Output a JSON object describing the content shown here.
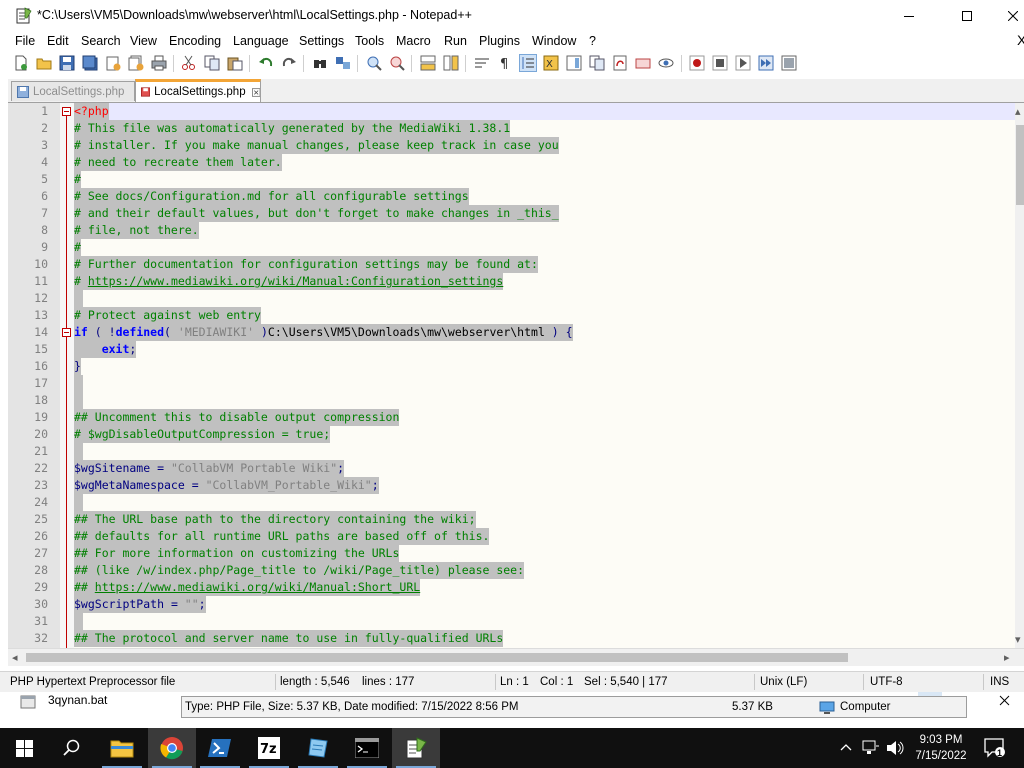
{
  "window": {
    "title": "*C:\\Users\\VM5\\Downloads\\mw\\webserver\\html\\LocalSettings.php - Notepad++"
  },
  "menu": {
    "items": [
      "File",
      "Edit",
      "Search",
      "View",
      "Encoding",
      "Language",
      "Settings",
      "Tools",
      "Macro",
      "Run",
      "Plugins",
      "Window",
      "?"
    ],
    "close_glyph": "X"
  },
  "toolbar": {
    "buttons": [
      "new-file",
      "open-file",
      "save",
      "save-all",
      "close",
      "close-all",
      "print",
      "cut",
      "copy",
      "paste",
      "undo",
      "redo",
      "find",
      "replace",
      "zoom-in",
      "zoom-out",
      "sync-vertical",
      "sync-horizontal",
      "word-wrap",
      "show-all-characters",
      "indent-guide",
      "user-defined-language",
      "document-map",
      "function-list",
      "folder-as-workspace",
      "monitoring",
      "start-recording",
      "stop-recording",
      "playback-macro",
      "run-macro-multiple",
      "save-macro"
    ]
  },
  "tabs": [
    {
      "label": "LocalSettings.php",
      "active": false
    },
    {
      "label": "LocalSettings.php",
      "active": true
    }
  ],
  "editor": {
    "lines": [
      {
        "n": "1",
        "tokens": [
          [
            "tag",
            "<?php"
          ]
        ]
      },
      {
        "n": "2",
        "tokens": [
          [
            "cmt",
            "# This file was automatically generated by the MediaWiki 1.38.1"
          ]
        ]
      },
      {
        "n": "3",
        "tokens": [
          [
            "cmt",
            "# installer. If you make manual changes, please keep track in case you"
          ]
        ]
      },
      {
        "n": "4",
        "tokens": [
          [
            "cmt",
            "# need to recreate them later."
          ]
        ]
      },
      {
        "n": "5",
        "tokens": [
          [
            "cmt",
            "#"
          ]
        ]
      },
      {
        "n": "6",
        "tokens": [
          [
            "cmt",
            "# See docs/Configuration.md for all configurable settings"
          ]
        ]
      },
      {
        "n": "7",
        "tokens": [
          [
            "cmt",
            "# and their default values, but don't forget to make changes in _this_"
          ]
        ]
      },
      {
        "n": "8",
        "tokens": [
          [
            "cmt",
            "# file, not there."
          ]
        ]
      },
      {
        "n": "9",
        "tokens": [
          [
            "cmt",
            "#"
          ]
        ]
      },
      {
        "n": "10",
        "tokens": [
          [
            "cmt",
            "# Further documentation for configuration settings may be found at:"
          ]
        ]
      },
      {
        "n": "11",
        "tokens": [
          [
            "cmt",
            "# "
          ],
          [
            "url",
            "https://www.mediawiki.org/wiki/Manual:Configuration_settings"
          ]
        ]
      },
      {
        "n": "12",
        "tokens": []
      },
      {
        "n": "13",
        "tokens": [
          [
            "cmt",
            "# Protect against web entry"
          ]
        ]
      },
      {
        "n": "14",
        "tokens": [
          [
            "kw",
            "if"
          ],
          [
            "op",
            " ( !"
          ],
          [
            "kw",
            "defined"
          ],
          [
            "op",
            "( "
          ],
          [
            "str",
            "'MEDIAWIKI'"
          ],
          [
            "op",
            " )"
          ],
          [
            "def",
            "C:\\Users\\VM5\\Downloads\\mw\\webserver\\html"
          ],
          [
            "op",
            " ) {"
          ]
        ]
      },
      {
        "n": "15",
        "tokens": [
          [
            "def",
            "    "
          ],
          [
            "kw",
            "exit"
          ],
          [
            "op",
            ";"
          ]
        ]
      },
      {
        "n": "16",
        "tokens": [
          [
            "op",
            "}"
          ]
        ]
      },
      {
        "n": "17",
        "tokens": []
      },
      {
        "n": "18",
        "tokens": []
      },
      {
        "n": "19",
        "tokens": [
          [
            "cmt",
            "## Uncomment this to disable output compression"
          ]
        ]
      },
      {
        "n": "20",
        "tokens": [
          [
            "cmt",
            "# $wgDisableOutputCompression = true;"
          ]
        ]
      },
      {
        "n": "21",
        "tokens": []
      },
      {
        "n": "22",
        "tokens": [
          [
            "var",
            "$wgSitename"
          ],
          [
            "op",
            " = "
          ],
          [
            "str",
            "\"CollabVM Portable Wiki\""
          ],
          [
            "op",
            ";"
          ]
        ]
      },
      {
        "n": "23",
        "tokens": [
          [
            "var",
            "$wgMetaNamespace"
          ],
          [
            "op",
            " = "
          ],
          [
            "str",
            "\"CollabVM_Portable_Wiki\""
          ],
          [
            "op",
            ";"
          ]
        ]
      },
      {
        "n": "24",
        "tokens": []
      },
      {
        "n": "25",
        "tokens": [
          [
            "cmt",
            "## The URL base path to the directory containing the wiki;"
          ]
        ]
      },
      {
        "n": "26",
        "tokens": [
          [
            "cmt",
            "## defaults for all runtime URL paths are based off of this."
          ]
        ]
      },
      {
        "n": "27",
        "tokens": [
          [
            "cmt",
            "## For more information on customizing the URLs"
          ]
        ]
      },
      {
        "n": "28",
        "tokens": [
          [
            "cmt",
            "## (like /w/index.php/Page_title to /wiki/Page_title) please see:"
          ]
        ]
      },
      {
        "n": "29",
        "tokens": [
          [
            "cmt",
            "## "
          ],
          [
            "url",
            "https://www.mediawiki.org/wiki/Manual:Short_URL"
          ]
        ]
      },
      {
        "n": "30",
        "tokens": [
          [
            "var",
            "$wgScriptPath"
          ],
          [
            "op",
            " = "
          ],
          [
            "str",
            "\"\""
          ],
          [
            "op",
            ";"
          ]
        ]
      },
      {
        "n": "31",
        "tokens": []
      },
      {
        "n": "32",
        "tokens": [
          [
            "cmt",
            "## The protocol and server name to use in fully-qualified URLs"
          ]
        ]
      }
    ]
  },
  "status": {
    "file_type": "PHP Hypertext Preprocessor file",
    "length": "length : 5,546",
    "lines": "lines : 177",
    "ln": "Ln : 1",
    "col": "Col : 1",
    "sel": "Sel : 5,540 | 177",
    "eol": "Unix (LF)",
    "encoding": "UTF-8",
    "mode": "INS"
  },
  "explorer": {
    "file_name": "3qynan.bat",
    "tooltip": {
      "info": "Type: PHP File, Size: 5.37 KB, Date modified: 7/15/2022 8:56 PM",
      "size": "5.37 KB",
      "location": "Computer"
    }
  },
  "taskbar": {
    "apps": [
      "file-explorer",
      "chrome",
      "powershell",
      "7zip",
      "notepad",
      "command-prompt",
      "notepad-plus-plus"
    ],
    "time": "9:03 PM",
    "date": "7/15/2022",
    "notification_count": "1"
  },
  "colors": {
    "selection": "#c0c0c0",
    "comment": "#008000",
    "keyword": "#0000ff",
    "string": "#808080",
    "variable": "#000080",
    "php_tag": "#ff0000",
    "active_tab_accent": "#f3a536"
  }
}
